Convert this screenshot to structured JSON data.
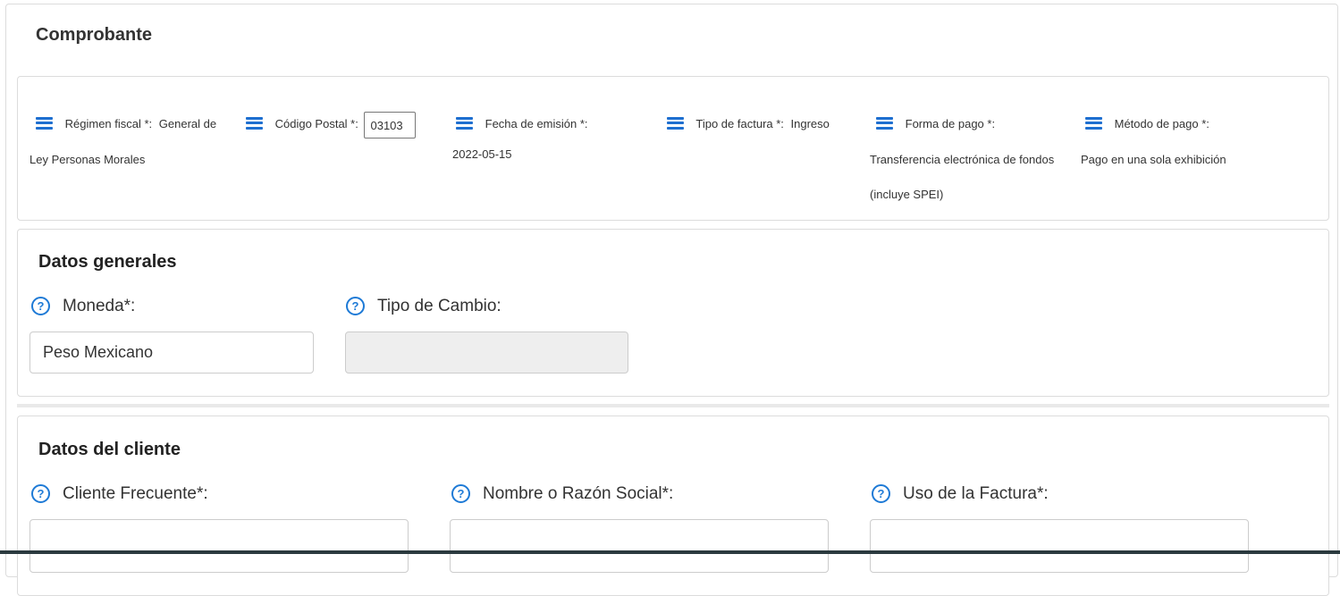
{
  "comprobante": {
    "title": "Comprobante",
    "regimen": {
      "icon": "list-icon",
      "label": "Régimen fiscal *:",
      "value_line1": "General de",
      "value_line2": "Ley Personas Morales"
    },
    "codigo_postal": {
      "icon": "list-icon",
      "label": "Código Postal *:",
      "value": "03103"
    },
    "fecha": {
      "icon": "list-icon",
      "label": "Fecha de emisión *:",
      "value": "2022-05-15"
    },
    "tipo_factura": {
      "icon": "list-icon",
      "label": "Tipo de factura *:",
      "value": "Ingreso"
    },
    "forma_pago": {
      "icon": "list-icon",
      "label": "Forma de pago *:",
      "value_line1": "Transferencia electrónica de fondos",
      "value_line2": "(incluye SPEI)"
    },
    "metodo_pago": {
      "icon": "list-icon",
      "label": "Método de pago *:",
      "value": "Pago en una sola exhibición"
    }
  },
  "datos_generales": {
    "title": "Datos generales",
    "moneda": {
      "label": "Moneda*:",
      "value": "Peso Mexicano"
    },
    "tipo_cambio": {
      "label": "Tipo de Cambio:",
      "value": ""
    }
  },
  "datos_cliente": {
    "title": "Datos del cliente",
    "cliente_frecuente": {
      "label": "Cliente Frecuente*:",
      "value": ""
    },
    "nombre": {
      "label": "Nombre o Razón Social*:",
      "value": ""
    },
    "uso_factura": {
      "label": "Uso de la Factura*:",
      "value": ""
    }
  },
  "colors": {
    "accent": "#1e6fd0",
    "help_icon": "#1e7ad6",
    "border": "#dcdcdc",
    "disabled_bg": "#eeeeee"
  }
}
